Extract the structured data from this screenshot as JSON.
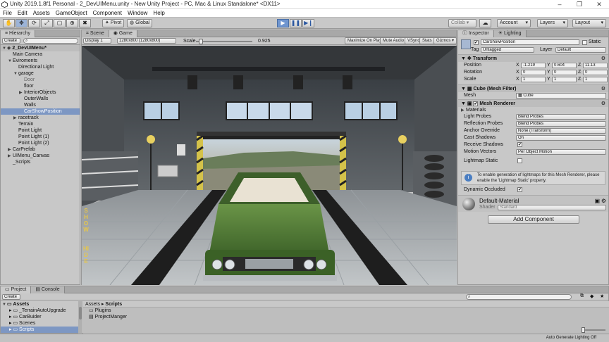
{
  "window": {
    "title": "Unity 2019.1.8f1 Personal - 2_DevUIMenu.unity - New Unity Project - PC, Mac & Linux Standalone* <DX11>"
  },
  "menu": [
    "File",
    "Edit",
    "Assets",
    "GameObject",
    "Component",
    "Window",
    "Help"
  ],
  "toolbar": {
    "pivot": "Pivot",
    "global": "Global",
    "collab": "Collab ▾",
    "account": "Account",
    "layers": "Layers",
    "layout": "Layout"
  },
  "hierarchy": {
    "tab": "Hierarchy",
    "create": "Create",
    "scene": "2_DevUIMenu*",
    "items": [
      {
        "label": "Main Camera",
        "depth": 1,
        "arrow": ""
      },
      {
        "label": "Eviroments",
        "depth": 1,
        "arrow": "▼"
      },
      {
        "label": "Directional Light",
        "depth": 2,
        "arrow": ""
      },
      {
        "label": "garage",
        "depth": 2,
        "arrow": "▼"
      },
      {
        "label": "Door",
        "depth": 3,
        "arrow": "",
        "gray": true
      },
      {
        "label": "floor",
        "depth": 3,
        "arrow": ""
      },
      {
        "label": "InteriorObjects",
        "depth": 3,
        "arrow": "▶"
      },
      {
        "label": "OuterWalls",
        "depth": 3,
        "arrow": ""
      },
      {
        "label": "Walls",
        "depth": 3,
        "arrow": ""
      },
      {
        "label": "CarShowPosition",
        "depth": 3,
        "arrow": "",
        "sel": true
      },
      {
        "label": "racetrack",
        "depth": 2,
        "arrow": "▶"
      },
      {
        "label": "Terrain",
        "depth": 2,
        "arrow": ""
      },
      {
        "label": "Point Light",
        "depth": 2,
        "arrow": ""
      },
      {
        "label": "Point Light (1)",
        "depth": 2,
        "arrow": ""
      },
      {
        "label": "Point Light (2)",
        "depth": 2,
        "arrow": ""
      },
      {
        "label": "CarPrefab",
        "depth": 1,
        "arrow": "▶"
      },
      {
        "label": "UIMenu_Canvas",
        "depth": 1,
        "arrow": "▶"
      },
      {
        "label": "_Scripts",
        "depth": 1,
        "arrow": ""
      }
    ]
  },
  "view": {
    "tabs": [
      "Scene",
      "Game"
    ],
    "display": "Display 1",
    "resolution": "1280x800 (1280x800)",
    "scale_label": "Scale",
    "scale_value": "0.925",
    "scale_fraction": 0.06,
    "toggles": [
      "Maximize On Play",
      "Mute Audio",
      "VSync",
      "Stats",
      "Gizmos ▾"
    ],
    "show_text": "SHOW",
    "hide_text": "HIDE"
  },
  "inspector": {
    "tabs": [
      "Inspector",
      "Lighting"
    ],
    "object_name": "CarShowPosition",
    "static": "Static",
    "tag_label": "Tag",
    "tag_value": "Untagged",
    "layer_label": "Layer",
    "layer_value": "Default",
    "transform": {
      "title": "Transform",
      "position_label": "Position",
      "rotation_label": "Rotation",
      "scale_label": "Scale",
      "position": [
        "-1.219",
        "0.604",
        "11.13"
      ],
      "rotation": [
        "0",
        "0",
        "0"
      ],
      "scale": [
        "1",
        "1",
        "1"
      ]
    },
    "mesh_filter": {
      "title": "Cube (Mesh Filter)",
      "mesh_label": "Mesh",
      "mesh_value": "Cube"
    },
    "mesh_renderer": {
      "title": "Mesh Renderer",
      "materials": "Materials",
      "props": [
        {
          "label": "Light Probes",
          "value": "Blend Probes"
        },
        {
          "label": "Reflection Probes",
          "value": "Blend Probes"
        },
        {
          "label": "Anchor Override",
          "value": "None (Transform)"
        },
        {
          "label": "Cast Shadows",
          "value": "On"
        },
        {
          "label": "Receive Shadows",
          "value": "✔"
        },
        {
          "label": "Motion Vectors",
          "value": "Per Object Motion"
        }
      ],
      "lightmap_static": "Lightmap Static",
      "info": "To enable generation of lightmaps for this Mesh Renderer, please enable the 'Lightmap Static' property.",
      "dynamic_occluded": "Dynamic Occluded"
    },
    "material": {
      "name": "Default-Material",
      "shader_label": "Shader",
      "shader_value": "Standard"
    },
    "add_component": "Add Component"
  },
  "project": {
    "tabs": [
      "Project",
      "Console"
    ],
    "create": "Create",
    "assets_root": "Assets",
    "folders": [
      "_TerrainAutoUpgrade",
      "CarBuider",
      "Scenes",
      "Scripts"
    ],
    "breadcrumb": [
      "Assets",
      "Scripts"
    ],
    "files": [
      "Plugins",
      "ProjectManger"
    ]
  },
  "status": {
    "text": "Auto Generate Lighting Off"
  },
  "colors": {
    "accent": "#6f95cf",
    "selection": "#7d97c3",
    "car": "#4f7a35"
  }
}
